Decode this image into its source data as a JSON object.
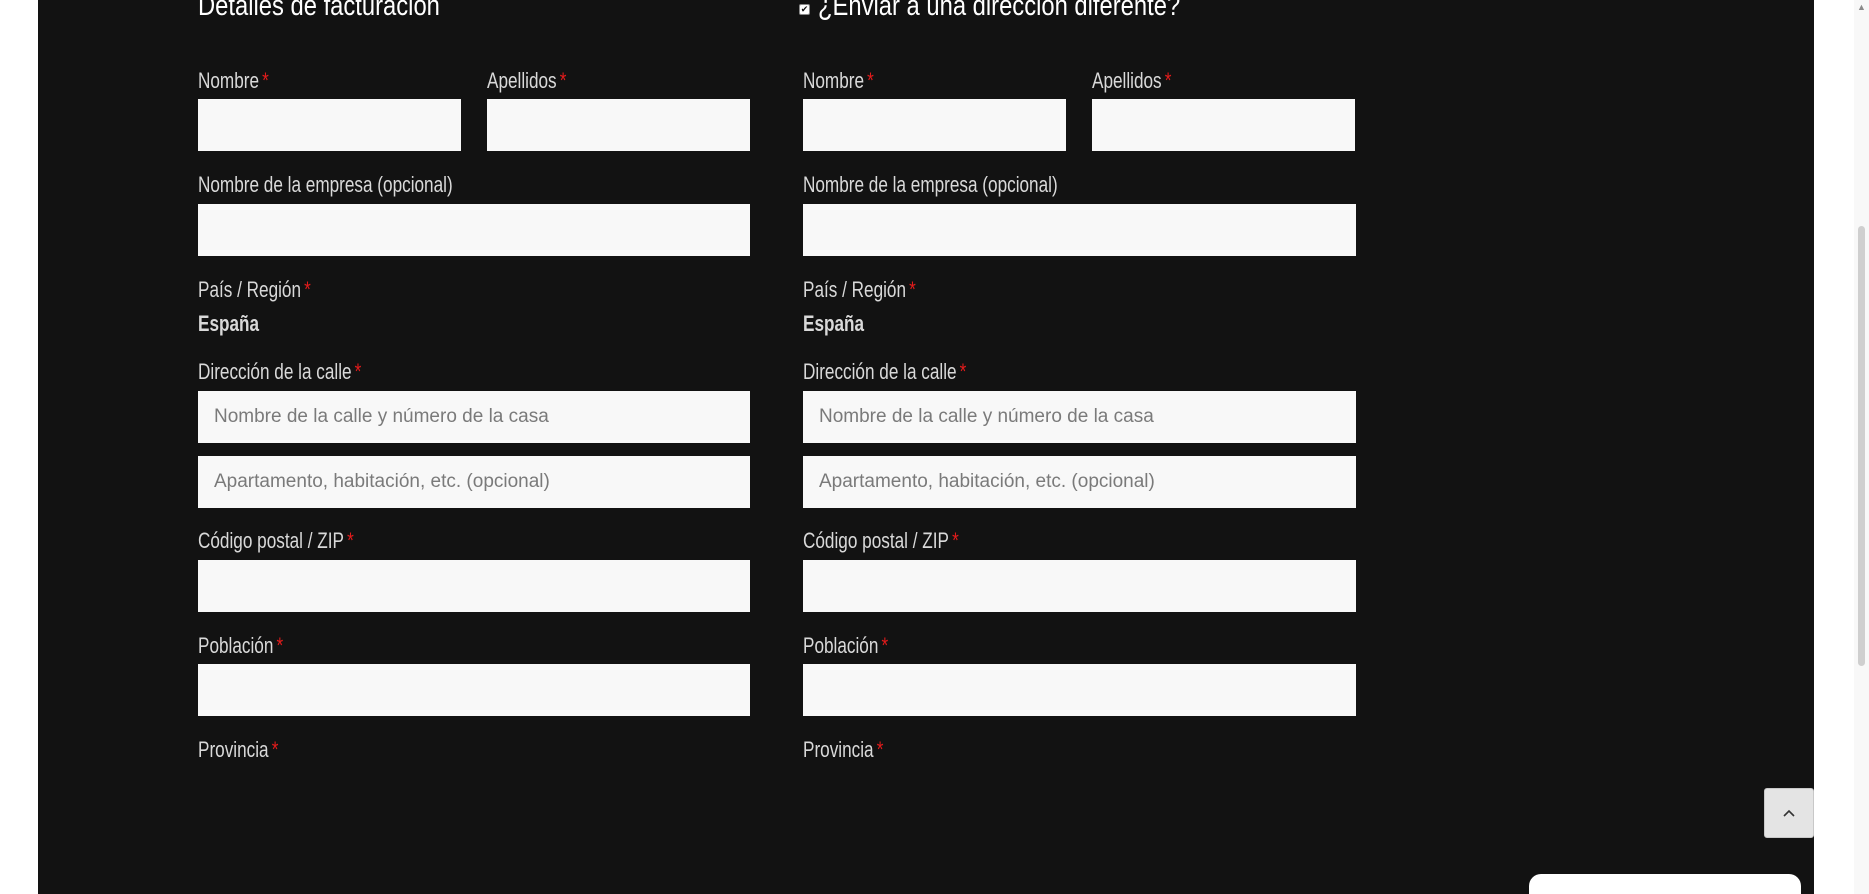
{
  "billing": {
    "title": "Detalles de facturación",
    "first_name_label": "Nombre",
    "last_name_label": "Apellidos",
    "company_label": "Nombre de la empresa (opcional)",
    "country_label": "País / Región",
    "country_value": "España",
    "street_label": "Dirección de la calle",
    "street1_placeholder": "Nombre de la calle y número de la casa",
    "street2_placeholder": "Apartamento, habitación, etc. (opcional)",
    "postcode_label": "Código postal / ZIP",
    "city_label": "Población",
    "province_label": "Provincia"
  },
  "shipping": {
    "toggle_label": "¿Enviar a una dirección diferente?",
    "toggle_checked": true,
    "first_name_label": "Nombre",
    "last_name_label": "Apellidos",
    "company_label": "Nombre de la empresa (opcional)",
    "country_label": "País / Región",
    "country_value": "España",
    "street_label": "Dirección de la calle",
    "street1_placeholder": "Nombre de la calle y número de la casa",
    "street2_placeholder": "Apartamento, habitación, etc. (opcional)",
    "postcode_label": "Código postal / ZIP",
    "city_label": "Población",
    "province_label": "Provincia"
  },
  "required_marker": "*",
  "icons": {
    "back_to_top": "chevron-up-icon",
    "checkbox": "checkbox-checked-icon"
  },
  "colors": {
    "panel_bg": "#121212",
    "input_bg": "#f8f8f8",
    "label": "#d9d9d9",
    "required": "#e41b1b"
  }
}
